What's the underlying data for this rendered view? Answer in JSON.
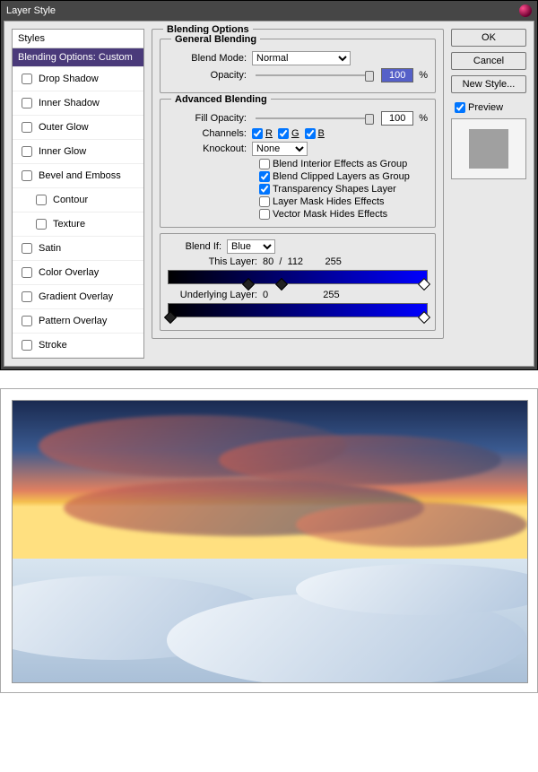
{
  "dialog": {
    "title": "Layer Style"
  },
  "styles": {
    "header": "Styles",
    "items": [
      {
        "label": "Blending Options: Custom",
        "checked": null,
        "active": true
      },
      {
        "label": "Drop Shadow",
        "checked": false
      },
      {
        "label": "Inner Shadow",
        "checked": false
      },
      {
        "label": "Outer Glow",
        "checked": false
      },
      {
        "label": "Inner Glow",
        "checked": false
      },
      {
        "label": "Bevel and Emboss",
        "checked": false
      },
      {
        "label": "Contour",
        "checked": false,
        "sub": true
      },
      {
        "label": "Texture",
        "checked": false,
        "sub": true
      },
      {
        "label": "Satin",
        "checked": false
      },
      {
        "label": "Color Overlay",
        "checked": false
      },
      {
        "label": "Gradient Overlay",
        "checked": false
      },
      {
        "label": "Pattern Overlay",
        "checked": false
      },
      {
        "label": "Stroke",
        "checked": false
      }
    ]
  },
  "blending": {
    "title": "Blending Options",
    "general": {
      "title": "General Blending",
      "blend_mode_label": "Blend Mode:",
      "blend_mode_value": "Normal",
      "opacity_label": "Opacity:",
      "opacity_value": "100",
      "opacity_unit": "%"
    },
    "advanced": {
      "title": "Advanced Blending",
      "fill_opacity_label": "Fill Opacity:",
      "fill_opacity_value": "100",
      "fill_opacity_unit": "%",
      "channels_label": "Channels:",
      "channel_r": "R",
      "channel_g": "G",
      "channel_b": "B",
      "knockout_label": "Knockout:",
      "knockout_value": "None",
      "opt1": {
        "label": "Blend Interior Effects as Group",
        "checked": false
      },
      "opt2": {
        "label": "Blend Clipped Layers as Group",
        "checked": true
      },
      "opt3": {
        "label": "Transparency Shapes Layer",
        "checked": true
      },
      "opt4": {
        "label": "Layer Mask Hides Effects",
        "checked": false
      },
      "opt5": {
        "label": "Vector Mask Hides Effects",
        "checked": false
      }
    },
    "blendif": {
      "label": "Blend If:",
      "value": "Blue",
      "this_layer_label": "This Layer:",
      "this_layer_vals": "80  /  112        255",
      "underlying_label": "Underlying Layer:",
      "underlying_vals": "0                    255"
    }
  },
  "buttons": {
    "ok": "OK",
    "cancel": "Cancel",
    "new_style": "New Style...",
    "preview": "Preview"
  }
}
